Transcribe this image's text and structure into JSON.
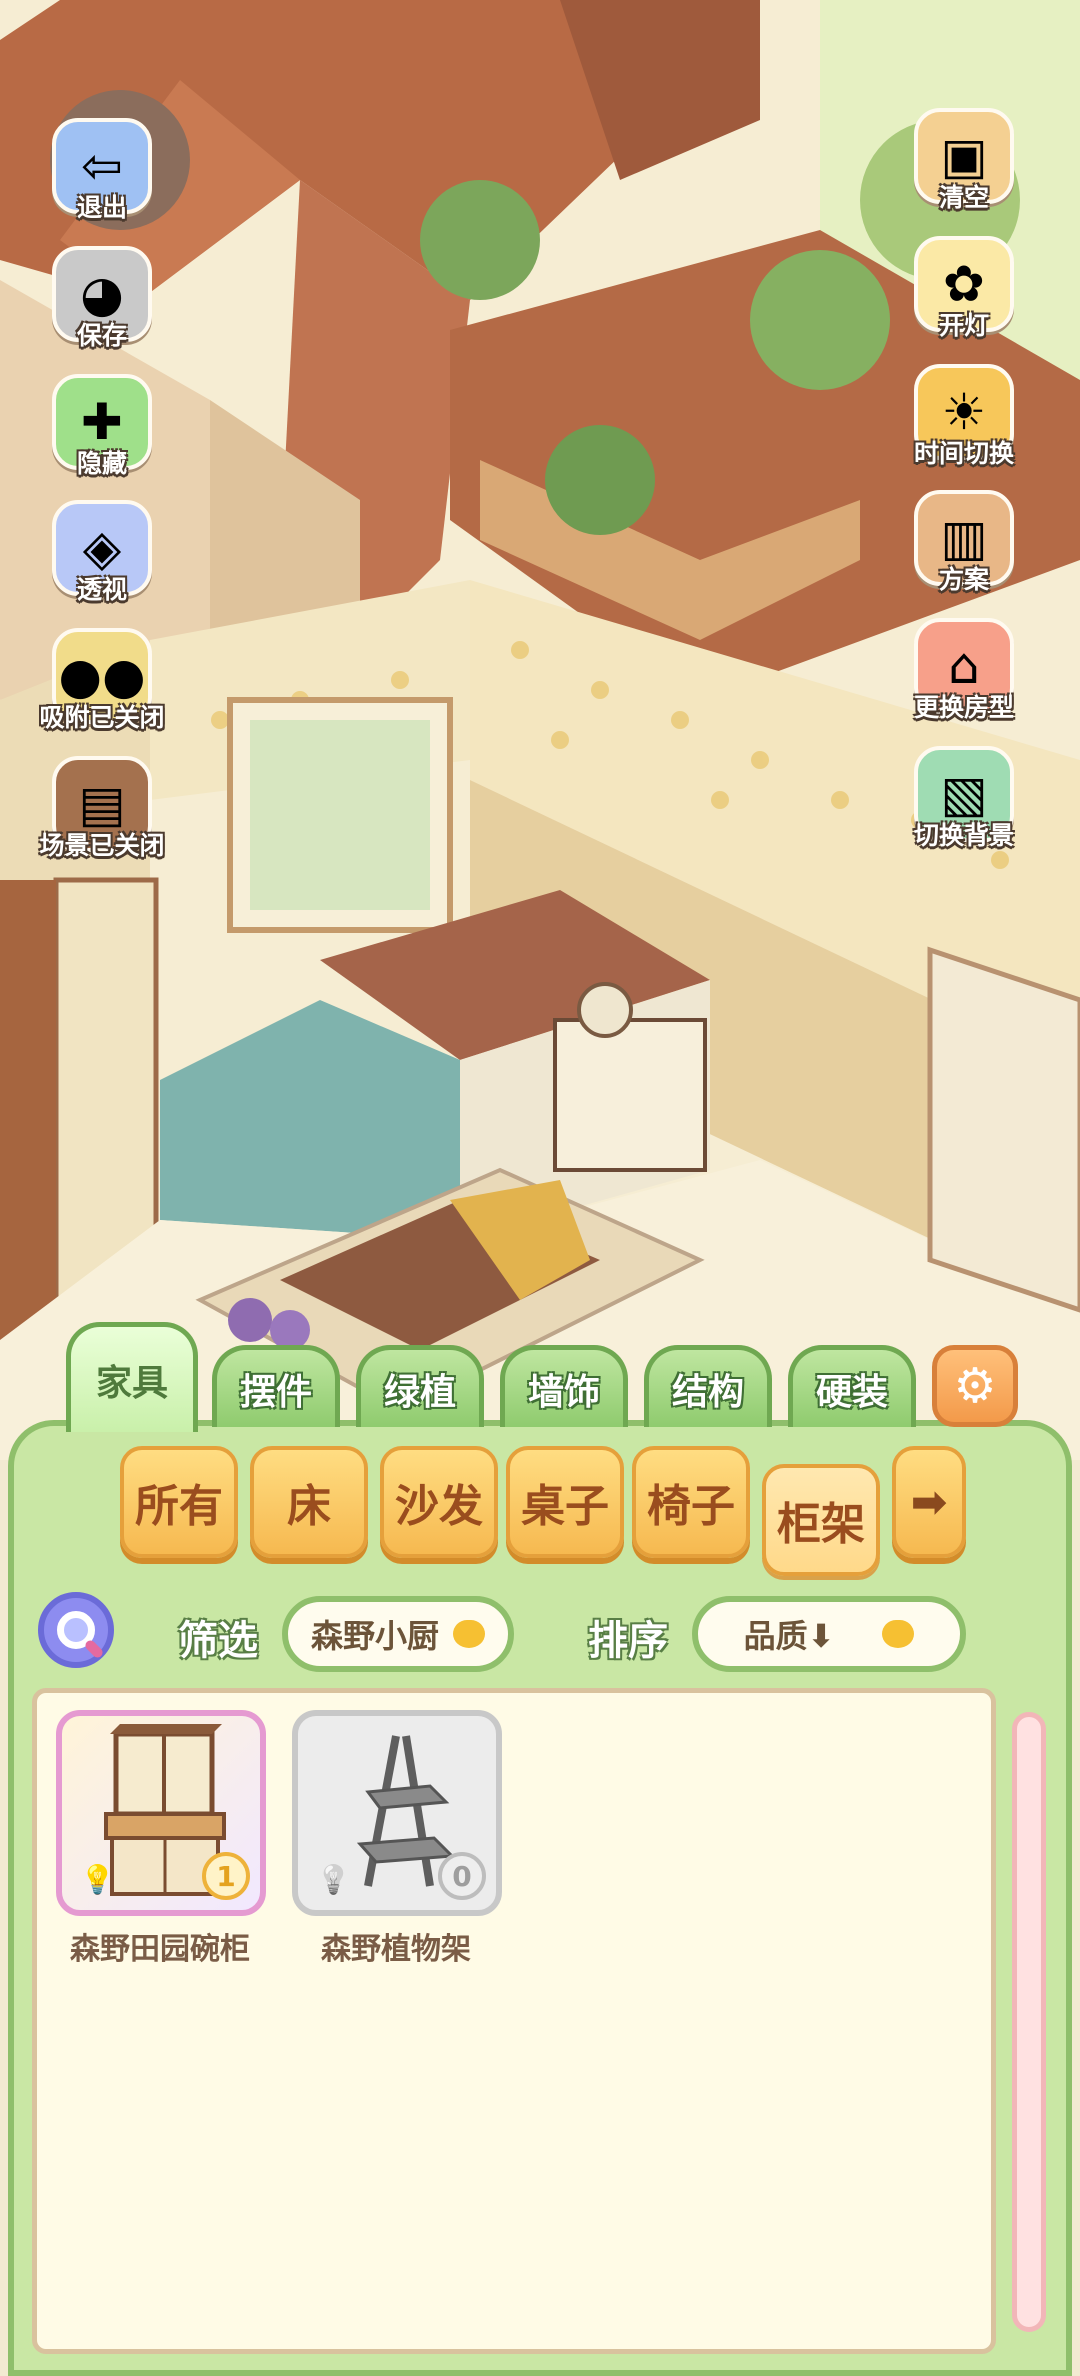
{
  "side_left": [
    {
      "label": "退出",
      "icon": "exit-door-icon"
    },
    {
      "label": "保存",
      "icon": "save-cat-icon"
    },
    {
      "label": "隐藏",
      "icon": "hide-frame-icon"
    },
    {
      "label": "透视",
      "icon": "perspective-cube-icon"
    },
    {
      "label": "吸附已关闭",
      "icon": "snap-chicks-icon"
    },
    {
      "label": "场景已关闭",
      "icon": "scene-window-icon"
    }
  ],
  "side_right": [
    {
      "label": "清空",
      "icon": "clear-box-icon"
    },
    {
      "label": "开灯",
      "icon": "light-lamp-icon"
    },
    {
      "label": "时间切换",
      "icon": "time-sun-moon-icon"
    },
    {
      "label": "方案",
      "icon": "plan-book-icon"
    },
    {
      "label": "更换房型",
      "icon": "house-layout-icon"
    },
    {
      "label": "切换背景",
      "icon": "background-swap-icon"
    }
  ],
  "category_tabs": [
    "家具",
    "摆件",
    "绿植",
    "墙饰",
    "结构",
    "硬装"
  ],
  "sub_tabs": [
    "所有",
    "床",
    "沙发",
    "桌子",
    "椅子",
    "柜架"
  ],
  "filter": {
    "label": "筛选",
    "value": "森野小厨"
  },
  "sort": {
    "label": "排序",
    "value": "品质⬇"
  },
  "items": [
    {
      "name": "森野田园碗柜",
      "count": "1",
      "rarity": "rare"
    },
    {
      "name": "森野植物架",
      "count": "0",
      "rarity": "common"
    }
  ],
  "colors": {
    "panel_green": "#c9e7a4",
    "tab_orange": "#f6b950",
    "rare_border": "#e59ad1"
  }
}
